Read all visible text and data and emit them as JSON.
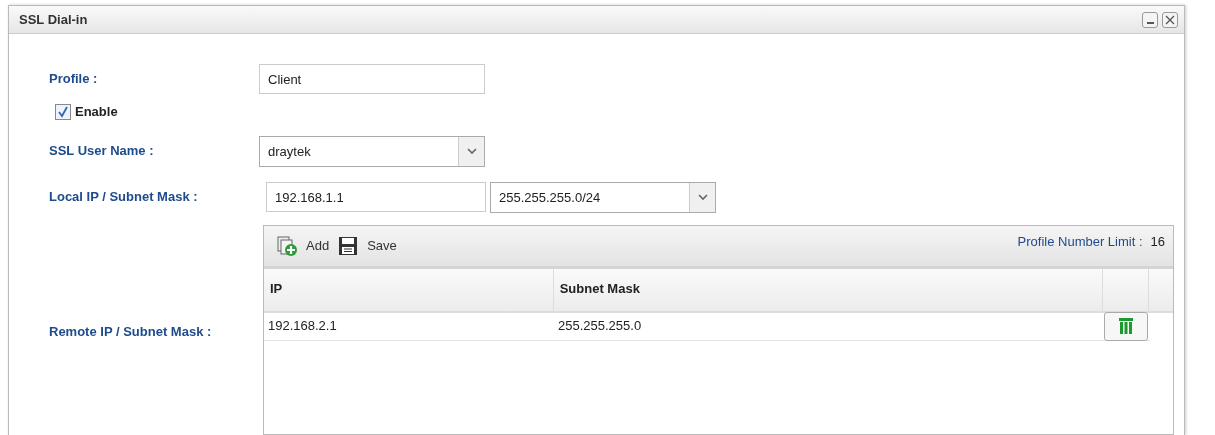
{
  "window": {
    "title": "SSL Dial-in"
  },
  "profile": {
    "label": "Profile :",
    "value": "Client"
  },
  "enable": {
    "label": "Enable",
    "checked": true
  },
  "ssl_user": {
    "label": "SSL User Name :",
    "value": "draytek"
  },
  "local_ip": {
    "label": "Local IP / Subnet Mask :",
    "ip": "192.168.1.1",
    "mask": "255.255.255.0/24"
  },
  "remote": {
    "label": "Remote IP / Subnet Mask :",
    "toolbar": [
      {
        "kind": "add",
        "label": "Add"
      },
      {
        "kind": "save",
        "label": "Save"
      }
    ],
    "limit_label": "Profile Number Limit :",
    "limit_value": "16",
    "columns": [
      "IP",
      "Subnet Mask"
    ],
    "rows": [
      {
        "ip": "192.168.2.1",
        "mask": "255.255.255.0"
      }
    ]
  }
}
